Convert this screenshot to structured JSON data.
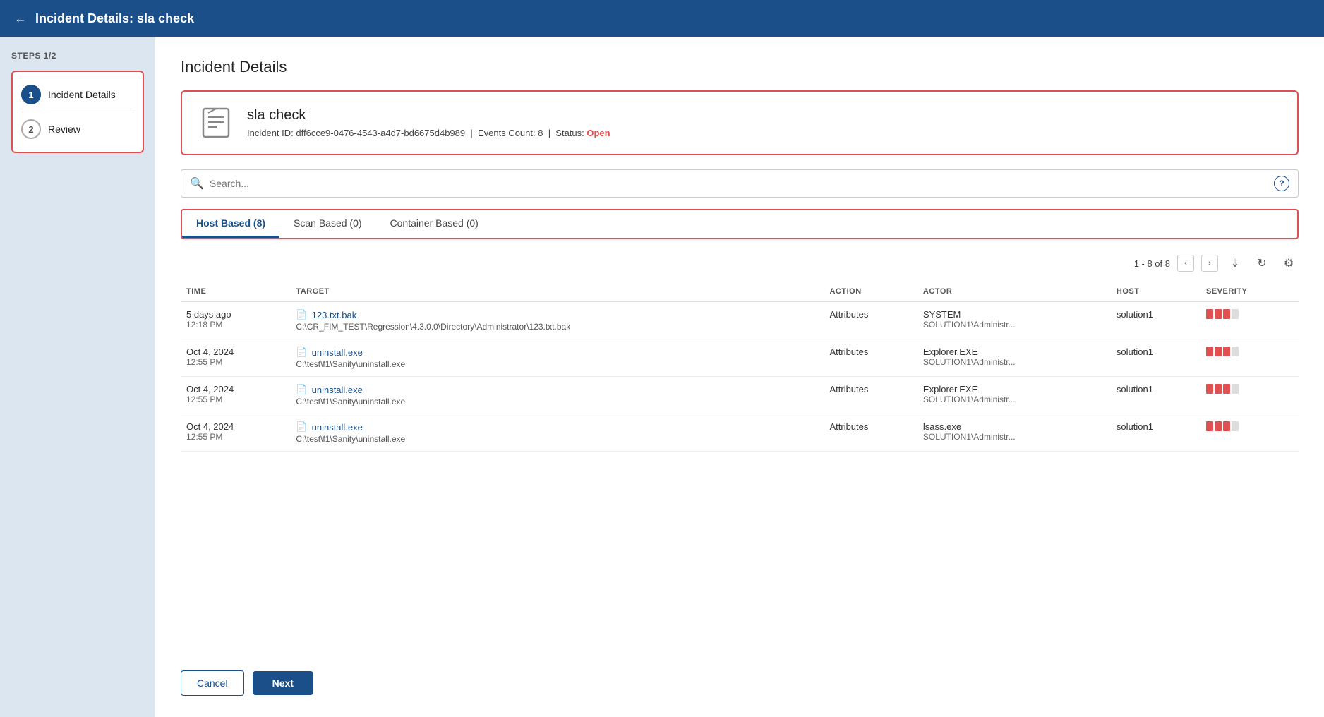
{
  "header": {
    "back_icon": "←",
    "title_prefix": "Incident Details: ",
    "title_name": "sla check"
  },
  "sidebar": {
    "steps_label": "STEPS 1/2",
    "steps": [
      {
        "number": "1",
        "label": "Incident Details",
        "active": true
      },
      {
        "number": "2",
        "label": "Review",
        "active": false
      }
    ]
  },
  "content": {
    "page_title": "Incident Details",
    "incident": {
      "name": "sla check",
      "incident_id_label": "Incident ID: ",
      "incident_id": "dff6cce9-0476-4543-a4d7-bd6675d4b989",
      "events_count_label": "Events Count: ",
      "events_count": "8",
      "status_label": "Status: ",
      "status": "Open"
    },
    "search": {
      "placeholder": "Search...",
      "help": "?"
    },
    "tabs": [
      {
        "label": "Host Based (8)",
        "active": true
      },
      {
        "label": "Scan Based (0)",
        "active": false
      },
      {
        "label": "Container Based (0)",
        "active": false
      }
    ],
    "table_pagination": "1 - 8 of 8",
    "table_columns": [
      "TIME",
      "TARGET",
      "ACTION",
      "ACTOR",
      "HOST",
      "SEVERITY"
    ],
    "table_rows": [
      {
        "time_main": "5 days ago",
        "time_sub": "12:18 PM",
        "file_name": "123.txt.bak",
        "file_path": "C:\\CR_FIM_TEST\\Regression\\4.3.0.0\\Directory\\Administrator\\123.txt.bak",
        "action": "Attributes",
        "actor_main": "SYSTEM",
        "actor_sub": "SOLUTION1\\Administr...",
        "host": "solution1",
        "severity": 3
      },
      {
        "time_main": "Oct 4, 2024",
        "time_sub": "12:55 PM",
        "file_name": "uninstall.exe",
        "file_path": "C:\\test\\f1\\Sanity\\uninstall.exe",
        "action": "Attributes",
        "actor_main": "Explorer.EXE",
        "actor_sub": "SOLUTION1\\Administr...",
        "host": "solution1",
        "severity": 3
      },
      {
        "time_main": "Oct 4, 2024",
        "time_sub": "12:55 PM",
        "file_name": "uninstall.exe",
        "file_path": "C:\\test\\f1\\Sanity\\uninstall.exe",
        "action": "Attributes",
        "actor_main": "Explorer.EXE",
        "actor_sub": "SOLUTION1\\Administr...",
        "host": "solution1",
        "severity": 3
      },
      {
        "time_main": "Oct 4, 2024",
        "time_sub": "12:55 PM",
        "file_name": "uninstall.exe",
        "file_path": "C:\\test\\f1\\Sanity\\uninstall.exe",
        "action": "Attributes",
        "actor_main": "lsass.exe",
        "actor_sub": "SOLUTION1\\Administr...",
        "host": "solution1",
        "severity": 3
      }
    ],
    "footer": {
      "cancel_label": "Cancel",
      "next_label": "Next"
    }
  }
}
